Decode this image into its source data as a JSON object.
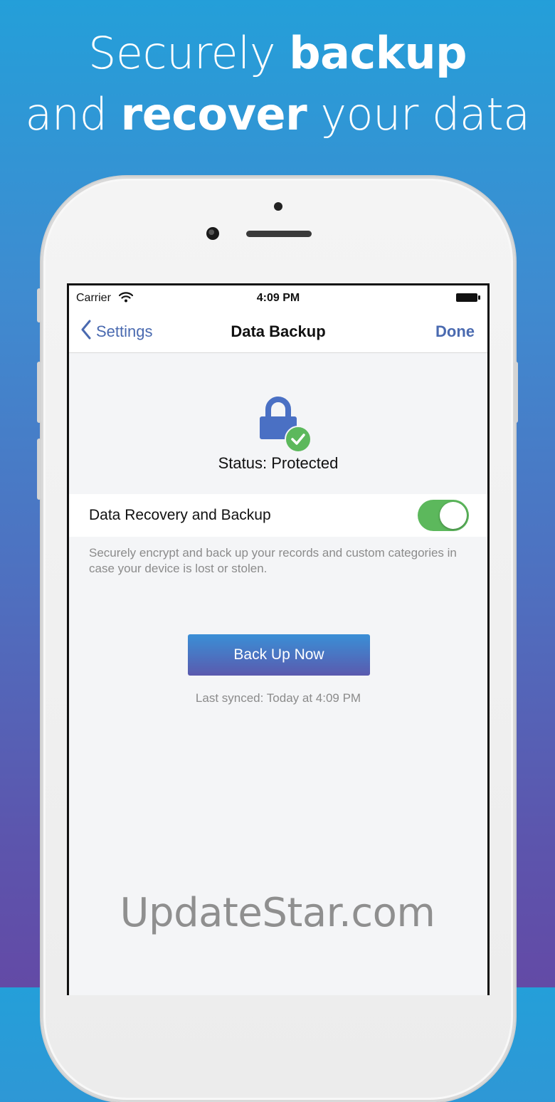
{
  "headline": {
    "line1_pre": "Securely ",
    "line1_bold": "backup",
    "line2_pre": "and ",
    "line2_bold": "recover",
    "line2_post": " your data"
  },
  "status_bar": {
    "carrier": "Carrier",
    "time": "4:09 PM"
  },
  "nav": {
    "back_label": "Settings",
    "title": "Data Backup",
    "done_label": "Done"
  },
  "status": {
    "text": "Status: Protected"
  },
  "setting_row": {
    "label": "Data Recovery and Backup",
    "enabled": true
  },
  "description": "Securely encrypt and back up your records and custom categories in case your device is lost or stolen.",
  "backup_button": {
    "label": "Back Up Now"
  },
  "last_synced": "Last synced: Today at 4:09 PM",
  "watermark": "UpdateStar.com",
  "colors": {
    "accent": "#4a6ab0",
    "toggle_on": "#5cb85c",
    "check": "#5cb85c",
    "lock": "#4a70c4"
  },
  "icons": [
    "chevron-left-icon",
    "wifi-icon",
    "battery-icon",
    "lock-icon",
    "check-icon"
  ]
}
